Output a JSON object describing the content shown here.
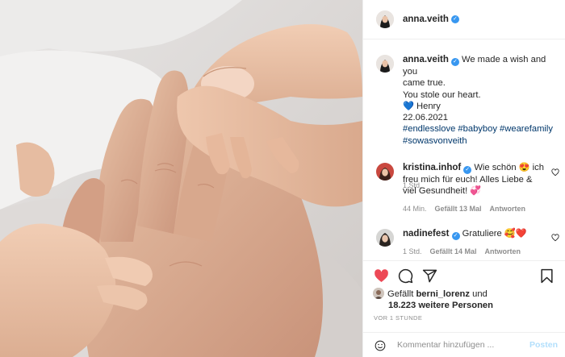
{
  "post": {
    "username": "anna.veith",
    "caption": {
      "lines": [
        "We made a wish and you",
        "came true.",
        "You stole our heart.",
        "💙 Henry",
        "22.06.2021"
      ],
      "hashtags": [
        "#endlesslove #babyboy #wearefamily",
        "#sowasvonveith"
      ],
      "time": "1 Std."
    },
    "comments": [
      {
        "username": "kristina.inhof",
        "text": "Wie schön 😍 ich freu mich für euch! Alles Liebe & viel Gesundheit! 💞",
        "time": "44 Min.",
        "likes": "Gefällt 13 Mal",
        "reply": "Antworten"
      },
      {
        "username": "nadinefest",
        "text": "Gratuliere 🥰❤️",
        "time": "1 Std.",
        "likes": "Gefällt 14 Mal",
        "reply": "Antworten"
      }
    ],
    "likes": {
      "prefix": "Gefällt",
      "user": "berni_lorenz",
      "connector": "und",
      "others": "18.223 weitere Personen"
    },
    "ago": "VOR 1 STUNDE",
    "composer": {
      "placeholder": "Kommentar hinzufügen ...",
      "post_label": "Posten"
    },
    "icons": [
      "heart-filled-icon",
      "comment-icon",
      "share-icon",
      "bookmark-icon",
      "emoji-icon",
      "verified-icon"
    ],
    "colors": {
      "like": "#ed4956",
      "verified": "#3897f0",
      "link": "#00376b",
      "post_button": "#b2dffc"
    }
  }
}
